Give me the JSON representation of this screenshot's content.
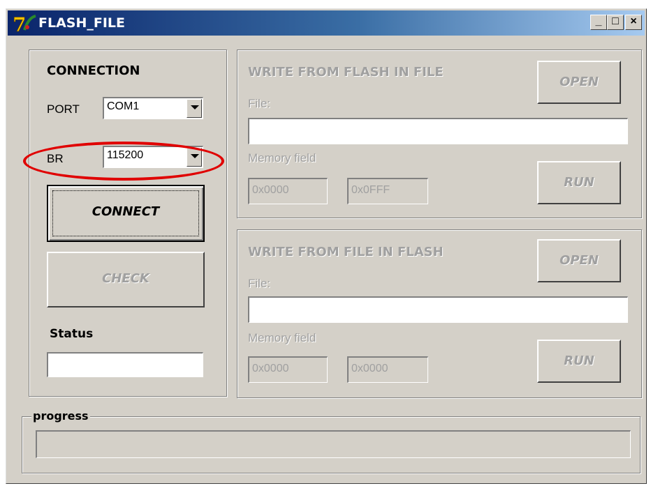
{
  "window": {
    "title": "FLASH_FILE",
    "controls": {
      "minimize": "_",
      "maximize": "□",
      "close": "×"
    }
  },
  "connection": {
    "heading": "CONNECTION",
    "port_label": "PORT",
    "port_value": "COM1",
    "br_label": "BR",
    "br_value": "115200",
    "connect_label": "CONNECT",
    "check_label": "CHECK",
    "status_label": "Status",
    "status_value": ""
  },
  "write_flash_to_file": {
    "heading": "WRITE FROM FLASH IN FILE",
    "open_label": "OPEN",
    "file_label": "File:",
    "file_value": "",
    "memory_label": "Memory field",
    "mem_start": "0x0000",
    "mem_end": "0x0FFF",
    "run_label": "RUN"
  },
  "write_file_to_flash": {
    "heading": "WRITE FROM FILE IN FLASH",
    "open_label": "OPEN",
    "file_label": "File:",
    "file_value": "",
    "memory_label": "Memory field",
    "mem_start": "0x0000",
    "mem_end": "0x0000",
    "run_label": "RUN"
  },
  "progress": {
    "label": "progress",
    "value": 0
  },
  "colors": {
    "annotation": "#e00000",
    "face": "#d4d0c8",
    "title_start": "#0a246a"
  }
}
